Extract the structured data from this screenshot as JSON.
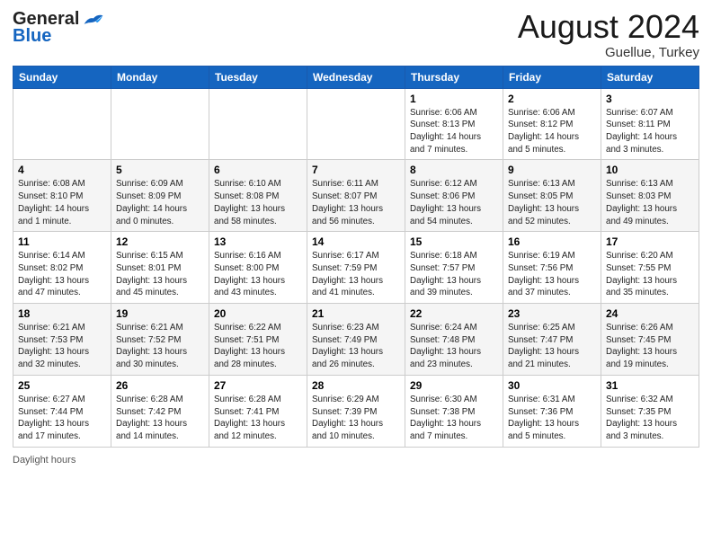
{
  "header": {
    "logo_general": "General",
    "logo_blue": "Blue",
    "title": "August 2024",
    "subtitle": "Guellue, Turkey"
  },
  "days_of_week": [
    "Sunday",
    "Monday",
    "Tuesday",
    "Wednesday",
    "Thursday",
    "Friday",
    "Saturday"
  ],
  "weeks": [
    [
      {
        "day": "",
        "info": ""
      },
      {
        "day": "",
        "info": ""
      },
      {
        "day": "",
        "info": ""
      },
      {
        "day": "",
        "info": ""
      },
      {
        "day": "1",
        "info": "Sunrise: 6:06 AM\nSunset: 8:13 PM\nDaylight: 14 hours and 7 minutes."
      },
      {
        "day": "2",
        "info": "Sunrise: 6:06 AM\nSunset: 8:12 PM\nDaylight: 14 hours and 5 minutes."
      },
      {
        "day": "3",
        "info": "Sunrise: 6:07 AM\nSunset: 8:11 PM\nDaylight: 14 hours and 3 minutes."
      }
    ],
    [
      {
        "day": "4",
        "info": "Sunrise: 6:08 AM\nSunset: 8:10 PM\nDaylight: 14 hours and 1 minute."
      },
      {
        "day": "5",
        "info": "Sunrise: 6:09 AM\nSunset: 8:09 PM\nDaylight: 14 hours and 0 minutes."
      },
      {
        "day": "6",
        "info": "Sunrise: 6:10 AM\nSunset: 8:08 PM\nDaylight: 13 hours and 58 minutes."
      },
      {
        "day": "7",
        "info": "Sunrise: 6:11 AM\nSunset: 8:07 PM\nDaylight: 13 hours and 56 minutes."
      },
      {
        "day": "8",
        "info": "Sunrise: 6:12 AM\nSunset: 8:06 PM\nDaylight: 13 hours and 54 minutes."
      },
      {
        "day": "9",
        "info": "Sunrise: 6:13 AM\nSunset: 8:05 PM\nDaylight: 13 hours and 52 minutes."
      },
      {
        "day": "10",
        "info": "Sunrise: 6:13 AM\nSunset: 8:03 PM\nDaylight: 13 hours and 49 minutes."
      }
    ],
    [
      {
        "day": "11",
        "info": "Sunrise: 6:14 AM\nSunset: 8:02 PM\nDaylight: 13 hours and 47 minutes."
      },
      {
        "day": "12",
        "info": "Sunrise: 6:15 AM\nSunset: 8:01 PM\nDaylight: 13 hours and 45 minutes."
      },
      {
        "day": "13",
        "info": "Sunrise: 6:16 AM\nSunset: 8:00 PM\nDaylight: 13 hours and 43 minutes."
      },
      {
        "day": "14",
        "info": "Sunrise: 6:17 AM\nSunset: 7:59 PM\nDaylight: 13 hours and 41 minutes."
      },
      {
        "day": "15",
        "info": "Sunrise: 6:18 AM\nSunset: 7:57 PM\nDaylight: 13 hours and 39 minutes."
      },
      {
        "day": "16",
        "info": "Sunrise: 6:19 AM\nSunset: 7:56 PM\nDaylight: 13 hours and 37 minutes."
      },
      {
        "day": "17",
        "info": "Sunrise: 6:20 AM\nSunset: 7:55 PM\nDaylight: 13 hours and 35 minutes."
      }
    ],
    [
      {
        "day": "18",
        "info": "Sunrise: 6:21 AM\nSunset: 7:53 PM\nDaylight: 13 hours and 32 minutes."
      },
      {
        "day": "19",
        "info": "Sunrise: 6:21 AM\nSunset: 7:52 PM\nDaylight: 13 hours and 30 minutes."
      },
      {
        "day": "20",
        "info": "Sunrise: 6:22 AM\nSunset: 7:51 PM\nDaylight: 13 hours and 28 minutes."
      },
      {
        "day": "21",
        "info": "Sunrise: 6:23 AM\nSunset: 7:49 PM\nDaylight: 13 hours and 26 minutes."
      },
      {
        "day": "22",
        "info": "Sunrise: 6:24 AM\nSunset: 7:48 PM\nDaylight: 13 hours and 23 minutes."
      },
      {
        "day": "23",
        "info": "Sunrise: 6:25 AM\nSunset: 7:47 PM\nDaylight: 13 hours and 21 minutes."
      },
      {
        "day": "24",
        "info": "Sunrise: 6:26 AM\nSunset: 7:45 PM\nDaylight: 13 hours and 19 minutes."
      }
    ],
    [
      {
        "day": "25",
        "info": "Sunrise: 6:27 AM\nSunset: 7:44 PM\nDaylight: 13 hours and 17 minutes."
      },
      {
        "day": "26",
        "info": "Sunrise: 6:28 AM\nSunset: 7:42 PM\nDaylight: 13 hours and 14 minutes."
      },
      {
        "day": "27",
        "info": "Sunrise: 6:28 AM\nSunset: 7:41 PM\nDaylight: 13 hours and 12 minutes."
      },
      {
        "day": "28",
        "info": "Sunrise: 6:29 AM\nSunset: 7:39 PM\nDaylight: 13 hours and 10 minutes."
      },
      {
        "day": "29",
        "info": "Sunrise: 6:30 AM\nSunset: 7:38 PM\nDaylight: 13 hours and 7 minutes."
      },
      {
        "day": "30",
        "info": "Sunrise: 6:31 AM\nSunset: 7:36 PM\nDaylight: 13 hours and 5 minutes."
      },
      {
        "day": "31",
        "info": "Sunrise: 6:32 AM\nSunset: 7:35 PM\nDaylight: 13 hours and 3 minutes."
      }
    ]
  ],
  "footer": {
    "daylight_label": "Daylight hours"
  }
}
